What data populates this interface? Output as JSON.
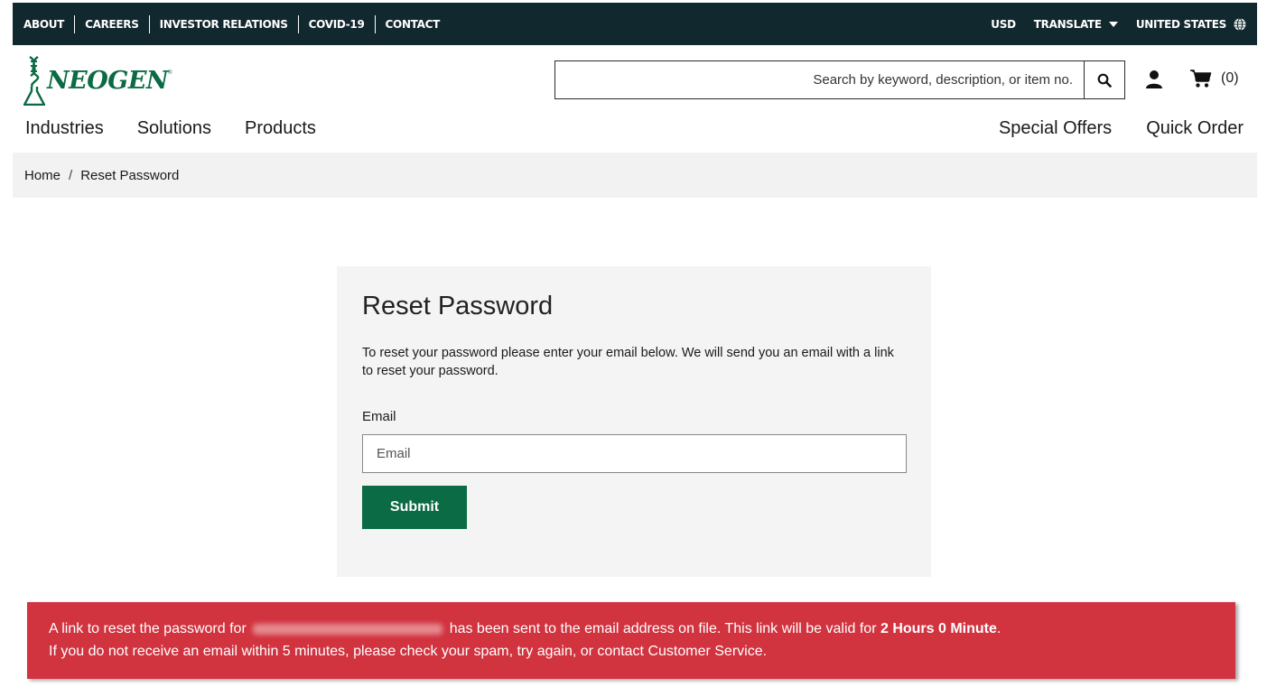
{
  "topbar": {
    "links": [
      "ABOUT",
      "CAREERS",
      "INVESTOR RELATIONS",
      "COVID-19",
      "CONTACT"
    ],
    "currency": "USD",
    "translate": "TRANSLATE",
    "region": "UNITED STATES"
  },
  "brand": {
    "name": "NEOGEN",
    "tm": "®"
  },
  "search": {
    "placeholder": "Search by keyword, description, or item no."
  },
  "cart": {
    "count": "(0)"
  },
  "nav": {
    "left": [
      "Industries",
      "Solutions",
      "Products"
    ],
    "right": [
      "Special Offers",
      "Quick Order"
    ]
  },
  "breadcrumb": {
    "home": "Home",
    "separator": "/",
    "current": "Reset Password"
  },
  "form": {
    "title": "Reset Password",
    "description": "To reset your password please enter your email below. We will send you an email with a link to reset your password.",
    "email_label": "Email",
    "email_placeholder": "Email",
    "submit_label": "Submit"
  },
  "alert": {
    "text_before": "A link to reset the password for",
    "text_after": "has been sent to the email address on file. This link will be valid for",
    "validity": "2 Hours 0 Minute",
    "line2": "If you do not receive an email within 5 minutes, please check your spam, try again, or contact Customer Service.",
    "background_color": "#d1333f"
  },
  "colors": {
    "brand_green": "#0a6b44",
    "topbar_bg": "#12282f"
  }
}
